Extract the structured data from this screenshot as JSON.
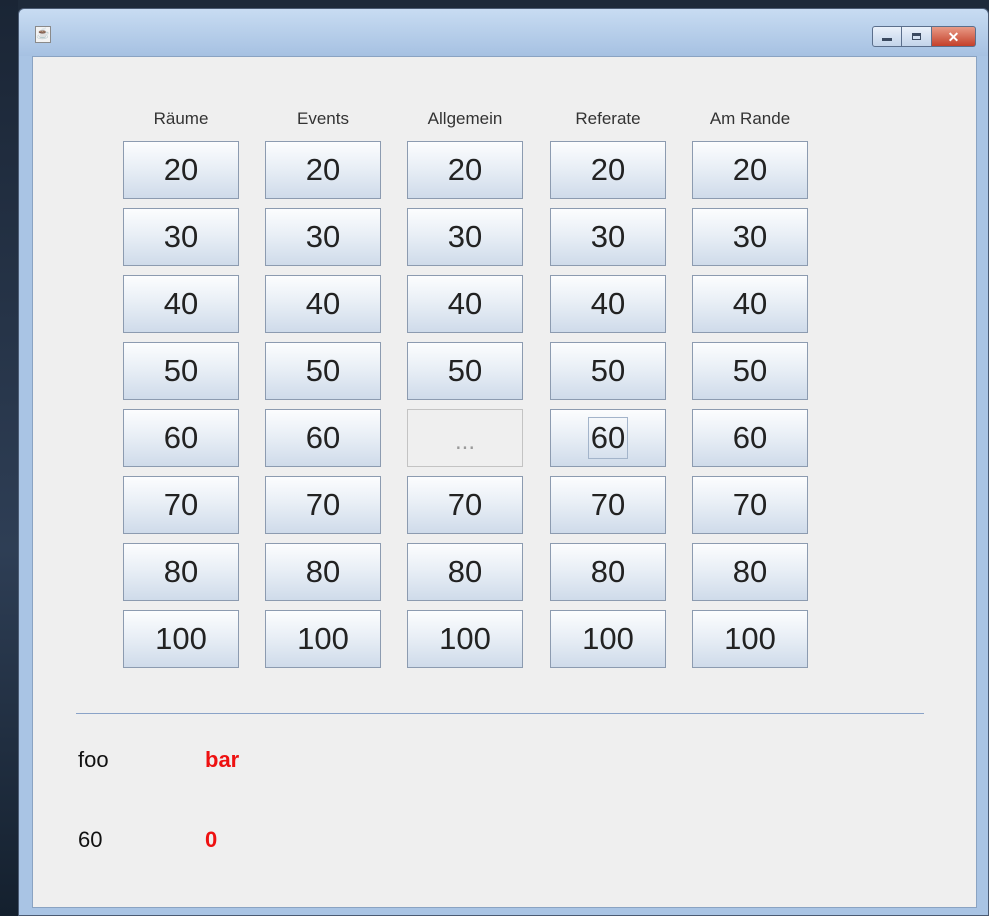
{
  "window": {
    "icon": "java-coffee-icon"
  },
  "categories": [
    "Räume",
    "Events",
    "Allgemein",
    "Referate",
    "Am Rande"
  ],
  "grid": [
    [
      "20",
      "20",
      "20",
      "20",
      "20"
    ],
    [
      "30",
      "30",
      "30",
      "30",
      "30"
    ],
    [
      "40",
      "40",
      "40",
      "40",
      "40"
    ],
    [
      "50",
      "50",
      "50",
      "50",
      "50"
    ],
    [
      "60",
      "60",
      "...",
      "60",
      "60"
    ],
    [
      "70",
      "70",
      "70",
      "70",
      "70"
    ],
    [
      "80",
      "80",
      "80",
      "80",
      "80"
    ],
    [
      "100",
      "100",
      "100",
      "100",
      "100"
    ]
  ],
  "status": {
    "label1": "foo",
    "value1": "bar",
    "label2": "60",
    "value2": "0"
  },
  "colors": {
    "accent_red": "#ee1111",
    "divider": "#8aa3c8"
  }
}
